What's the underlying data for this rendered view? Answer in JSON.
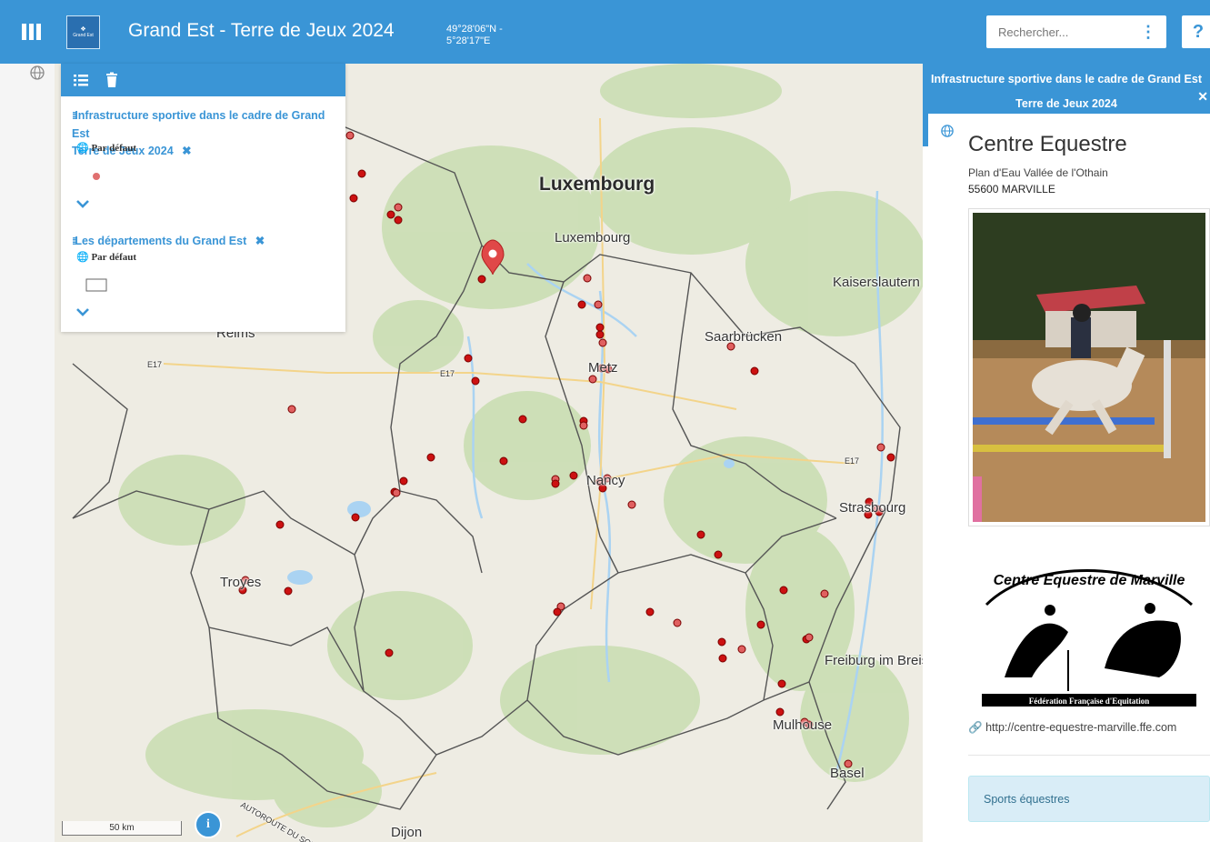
{
  "header": {
    "menu_icon": "bars-icon",
    "logo_icon": "region-logo-icon",
    "logo_text": "Grand Est",
    "title": "Grand Est - Terre de Jeux 2024",
    "coords_line1": "49°28'06\"N -",
    "coords_line2": "5°28'17\"E",
    "search_placeholder": "Rechercher...",
    "search_options_icon": "kebab-vertical-icon",
    "help_label": "?"
  },
  "colors": {
    "primary": "#3a95d6",
    "marker": "#cc1111",
    "border_dept": "#555555",
    "water": "#aad3f2",
    "forest": "#c8ddb0",
    "land": "#eeece3"
  },
  "legend": {
    "tools": [
      "list-icon",
      "trash-icon"
    ],
    "layers": [
      {
        "title_line1": "Infrastructure sportive dans le cadre de Grand Est",
        "title_line2": "Terre de Jeux 2024",
        "close": "✖",
        "style_label": "Par défaut",
        "symbol": "dot"
      },
      {
        "title_line1": "Les départements du Grand Est",
        "close": "✖",
        "style_label": "Par défaut",
        "symbol": "rectangle"
      }
    ]
  },
  "map": {
    "labels": {
      "luxembourg_country": "Luxembourg",
      "luxembourg_city": "Luxembourg",
      "kaiserslautern": "Kaiserslautern",
      "saarbrucken": "Saarbrücken",
      "metz": "Metz",
      "nancy": "Nancy",
      "reims": "Reims",
      "strasbourg": "Strasbourg",
      "troyes": "Troyes",
      "freiburg": "Freiburg im Breisgau",
      "mulhouse": "Mulhouse",
      "basel": "Basel",
      "dijon": "Dijon",
      "e17a": "E17",
      "e17b": "E17",
      "e17c": "E17",
      "autoroute": "AUTOROUTE DU SOLEIL"
    },
    "scale_label": "50 km",
    "info_label": "i"
  },
  "detail": {
    "layer_title_line1": "Infrastructure sportive dans le cadre de Grand Est",
    "layer_title_line2": "Terre de Jeux 2024",
    "close": "✕",
    "name": "Centre Equestre",
    "address_line1": "Plan d'Eau Vallée de l'Othain",
    "address_line2": "55600 MARVILLE",
    "photo_alt": "Cavalière sautant un obstacle",
    "logo_text_top": "Centre Equestre de Marville",
    "logo_text_bottom": "Fédération Française d'Equitation",
    "website": "http://centre-equestre-marville.ffe.com",
    "category": "Sports équestres"
  }
}
